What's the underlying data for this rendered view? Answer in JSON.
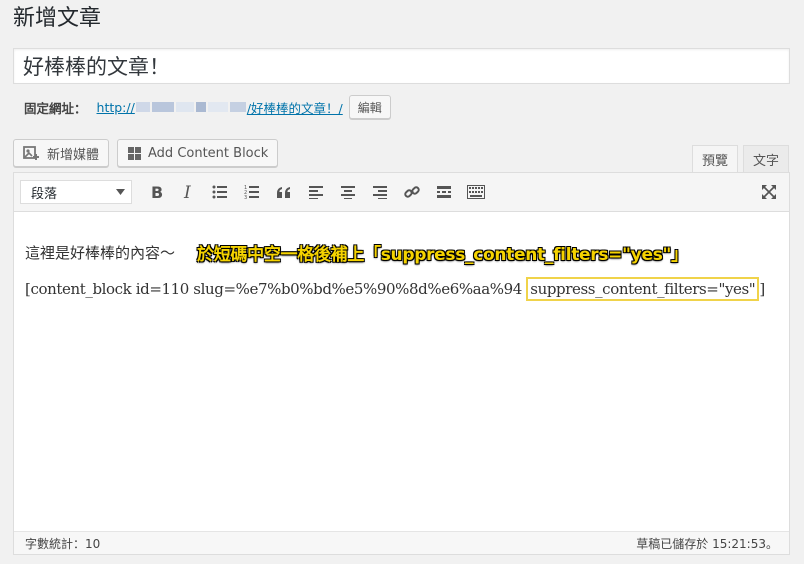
{
  "page": {
    "title": "新增文章"
  },
  "post": {
    "title": "好棒棒的文章！"
  },
  "permalink": {
    "label": "固定網址：",
    "url_prefix": "http://",
    "url_slug": "/好棒棒的文章！/",
    "edit_label": "編輯"
  },
  "media": {
    "add_media_label": "新增媒體",
    "add_content_block_label": "Add Content Block"
  },
  "tabs": [
    {
      "label": "預覽",
      "active": true
    },
    {
      "label": "文字",
      "active": false
    }
  ],
  "toolbar": {
    "format_value": "段落",
    "icons": [
      "bold-icon",
      "italic-icon",
      "bullet-list-icon",
      "numbered-list-icon",
      "blockquote-icon",
      "align-left-icon",
      "align-center-icon",
      "align-right-icon",
      "link-icon",
      "read-more-icon",
      "toolbar-toggle-icon",
      "fullscreen-icon"
    ]
  },
  "content": {
    "paragraph1": "這裡是好棒棒的內容～",
    "annotation": "於短碼中空一格後補上「suppress_content_filters=\"yes\"」",
    "shortcode_start": "[content_block id=110 slug=%e7%b0%bd%e5%90%8d%e6%aa%94 ",
    "shortcode_highlight": "suppress_content_filters=\"yes\"",
    "shortcode_end": "]"
  },
  "status": {
    "word_count": "字數統計：10",
    "saved": "草稿已儲存於 15:21:53。"
  },
  "colors": {
    "link": "#0073aa",
    "annotation": "#f5d300",
    "highlight_border": "#f0d34a"
  }
}
